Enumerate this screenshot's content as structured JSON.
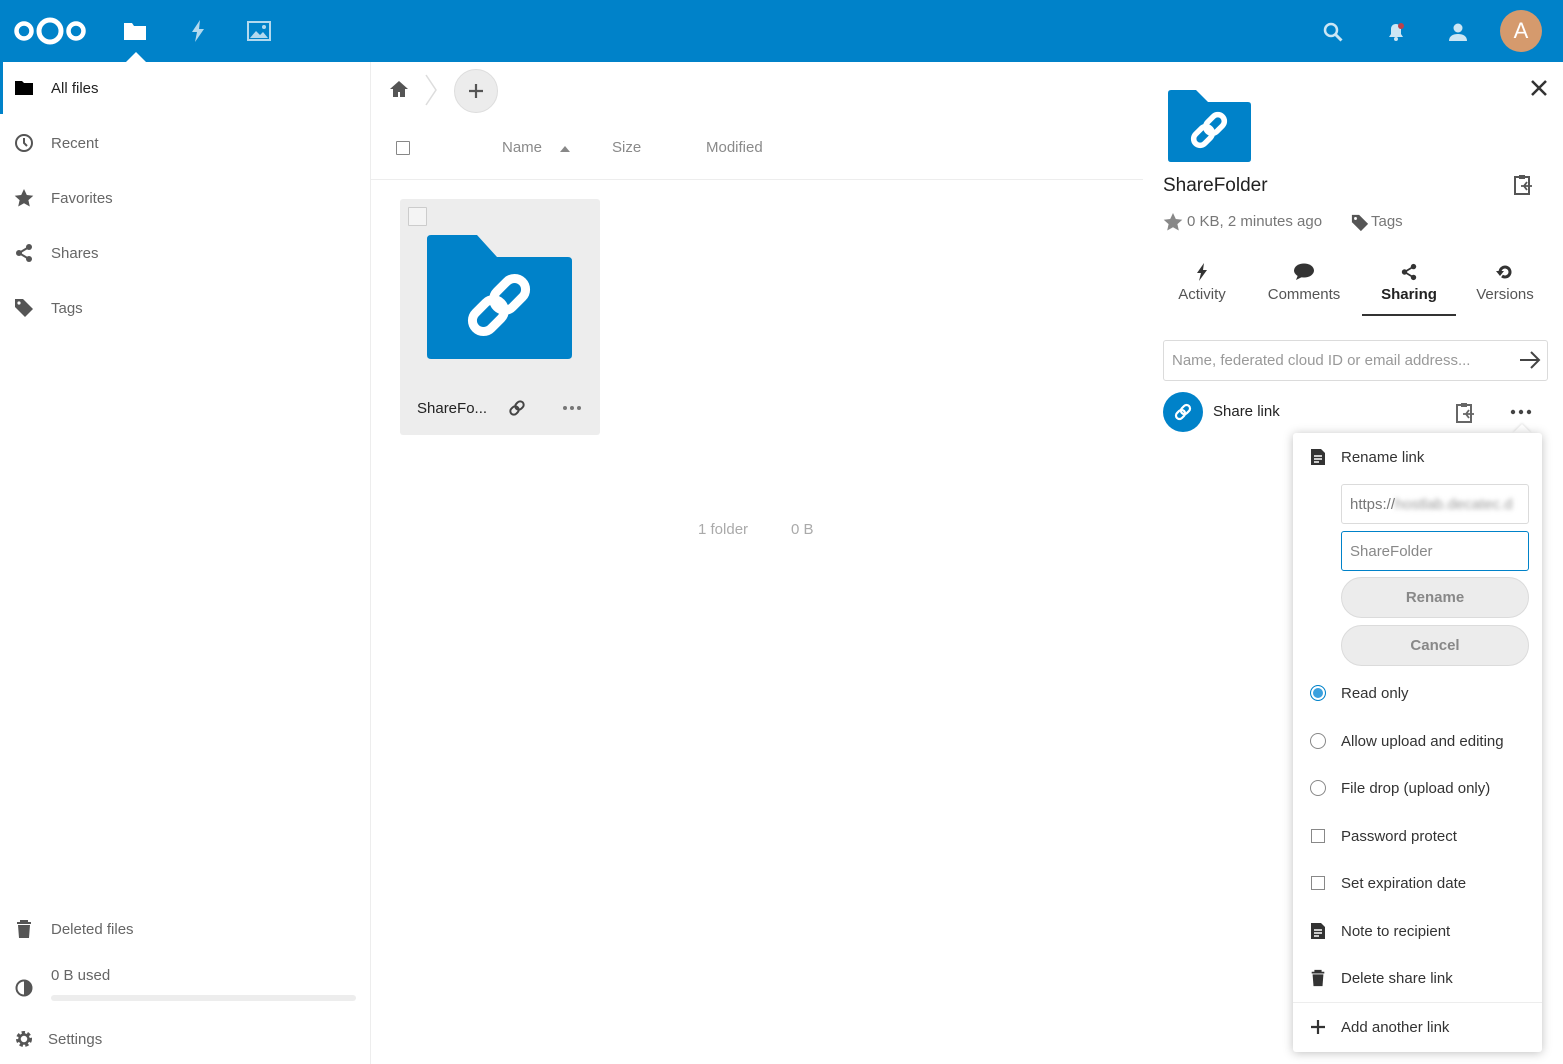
{
  "header": {
    "apps": [
      {
        "name": "files-app",
        "icon": "folder-icon"
      },
      {
        "name": "activity-app",
        "icon": "lightning-icon"
      },
      {
        "name": "gallery-app",
        "icon": "image-icon"
      }
    ],
    "avatar_initial": "A",
    "accent": "#0082c9"
  },
  "nav": {
    "items": [
      {
        "label": "All files",
        "icon": "folder-icon"
      },
      {
        "label": "Recent",
        "icon": "clock-icon"
      },
      {
        "label": "Favorites",
        "icon": "star-icon"
      },
      {
        "label": "Shares",
        "icon": "share-icon"
      },
      {
        "label": "Tags",
        "icon": "tag-icon"
      }
    ],
    "deleted_label": "Deleted files",
    "quota_label": "0 B used",
    "quota_fraction": 0,
    "settings_label": "Settings"
  },
  "main": {
    "columns": {
      "name": "Name",
      "size": "Size",
      "modified": "Modified"
    },
    "files": [
      {
        "name": "ShareFo...",
        "type": "folder",
        "shared_link": true
      }
    ],
    "summary": {
      "folders": "1 folder",
      "size": "0 B"
    }
  },
  "sidebar": {
    "title": "ShareFolder",
    "meta": "0 KB, 2 minutes ago",
    "tags_label": "Tags",
    "tabs": [
      {
        "label": "Activity",
        "icon": "lightning-icon"
      },
      {
        "label": "Comments",
        "icon": "comment-icon"
      },
      {
        "label": "Sharing",
        "icon": "share-icon",
        "active": true
      },
      {
        "label": "Versions",
        "icon": "history-icon"
      }
    ],
    "share_input_placeholder": "Name, federated cloud ID or email address...",
    "share_link_label": "Share link"
  },
  "menu": {
    "rename_link": "Rename link",
    "url_prefix": "https://",
    "url_host_blurred": "hostlab.decatec.d",
    "name_value": "ShareFolder",
    "rename_btn": "Rename",
    "cancel_btn": "Cancel",
    "permissions": [
      {
        "label": "Read only",
        "selected": true
      },
      {
        "label": "Allow upload and editing",
        "selected": false
      },
      {
        "label": "File drop (upload only)",
        "selected": false
      }
    ],
    "password_protect": "Password protect",
    "set_expiration": "Set expiration date",
    "note_to_recipient": "Note to recipient",
    "delete_share_link": "Delete share link",
    "add_another_link": "Add another link"
  }
}
